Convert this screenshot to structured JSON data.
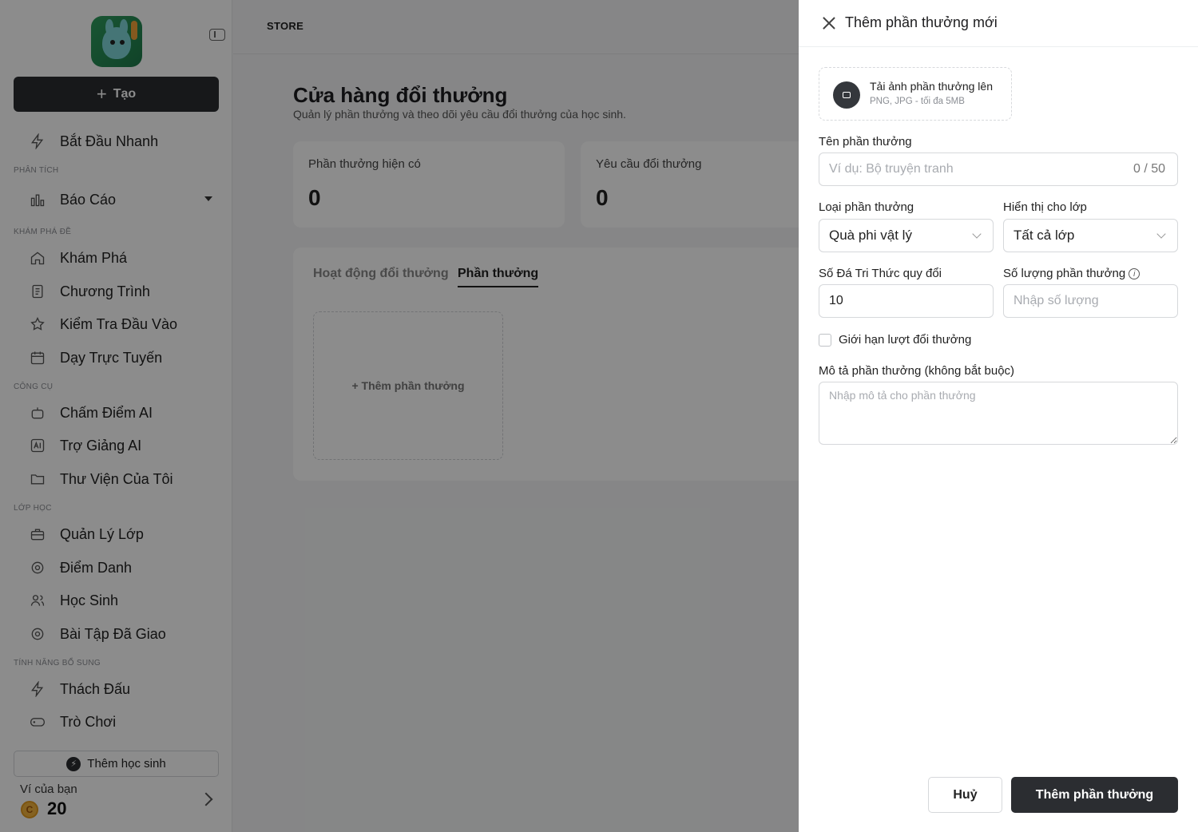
{
  "sidebar": {
    "create_label": "Tạo",
    "quick_start": "Bắt Đầu Nhanh",
    "sections": {
      "analytics": "PHÂN TÍCH",
      "explore": "KHÁM PHÁ ĐỀ",
      "tools": "CÔNG CỤ",
      "classes": "LỚP HỌC",
      "extras": "TÍNH NĂNG BỔ SUNG"
    },
    "items": {
      "reports": "Báo Cáo",
      "explore": "Khám Phá",
      "curriculum": "Chương Trình",
      "placement_test": "Kiểm Tra Đầu Vào",
      "online_teaching": "Dạy Trực Tuyến",
      "ai_grading": "Chấm Điểm AI",
      "ai_assistant": "Trợ Giảng AI",
      "my_library": "Thư Viện Của Tôi",
      "class_management": "Quản Lý Lớp",
      "attendance": "Điểm Danh",
      "students": "Học Sinh",
      "assigned_homework": "Bài Tập Đã Giao",
      "challenge": "Thách Đấu",
      "games": "Trò Chơi"
    },
    "add_student_label": "Thêm học sinh",
    "wallet": {
      "label": "Ví của bạn",
      "coin_symbol": "C",
      "value": "20"
    }
  },
  "topbar": {
    "breadcrumb": "STORE"
  },
  "main": {
    "title": "Cửa hàng đổi thưởng",
    "subtitle": "Quản lý phần thưởng và theo dõi yêu cầu đổi thưởng của học sinh.",
    "stats": [
      {
        "label": "Phần thưởng hiện có",
        "value": "0"
      },
      {
        "label": "Yêu cầu đổi thưởng",
        "value": "0"
      }
    ],
    "tabs": [
      {
        "label": "Hoạt động đổi thưởng",
        "active": false
      },
      {
        "label": "Phần thưởng",
        "active": true
      }
    ],
    "add_reward_tile": "+ Thêm phần thưởng"
  },
  "drawer": {
    "title": "Thêm phần thưởng mới",
    "upload": {
      "title": "Tải ảnh phần thưởng lên",
      "hint": "PNG, JPG - tối đa 5MB"
    },
    "reward_name": {
      "label": "Tên phần thưởng",
      "placeholder": "Ví dụ: Bộ truyện tranh",
      "value": "",
      "counter": "0 / 50"
    },
    "reward_type": {
      "label": "Loại phần thưởng",
      "value": "Quà phi vật lý"
    },
    "visible_to_class": {
      "label": "Hiển thị cho lớp",
      "value": "Tất cả lớp"
    },
    "knowledge_stones": {
      "label": "Số Đá Tri Thức quy đổi",
      "value": "10"
    },
    "quantity": {
      "label": "Số lượng phần thưởng",
      "placeholder": "Nhập số lượng",
      "value": ""
    },
    "limit_checkbox": {
      "label": "Giới hạn lượt đổi thưởng",
      "checked": false
    },
    "description": {
      "label": "Mô tả phần thưởng (không bắt buộc)",
      "placeholder": "Nhập mô tả cho phần thưởng"
    },
    "cancel_label": "Huỷ",
    "submit_label": "Thêm phần thưởng"
  },
  "colors": {
    "primary_dark": "#2b2d31",
    "overlay": "rgba(0,0,0,0.45)",
    "coin": "#f3b33d"
  }
}
